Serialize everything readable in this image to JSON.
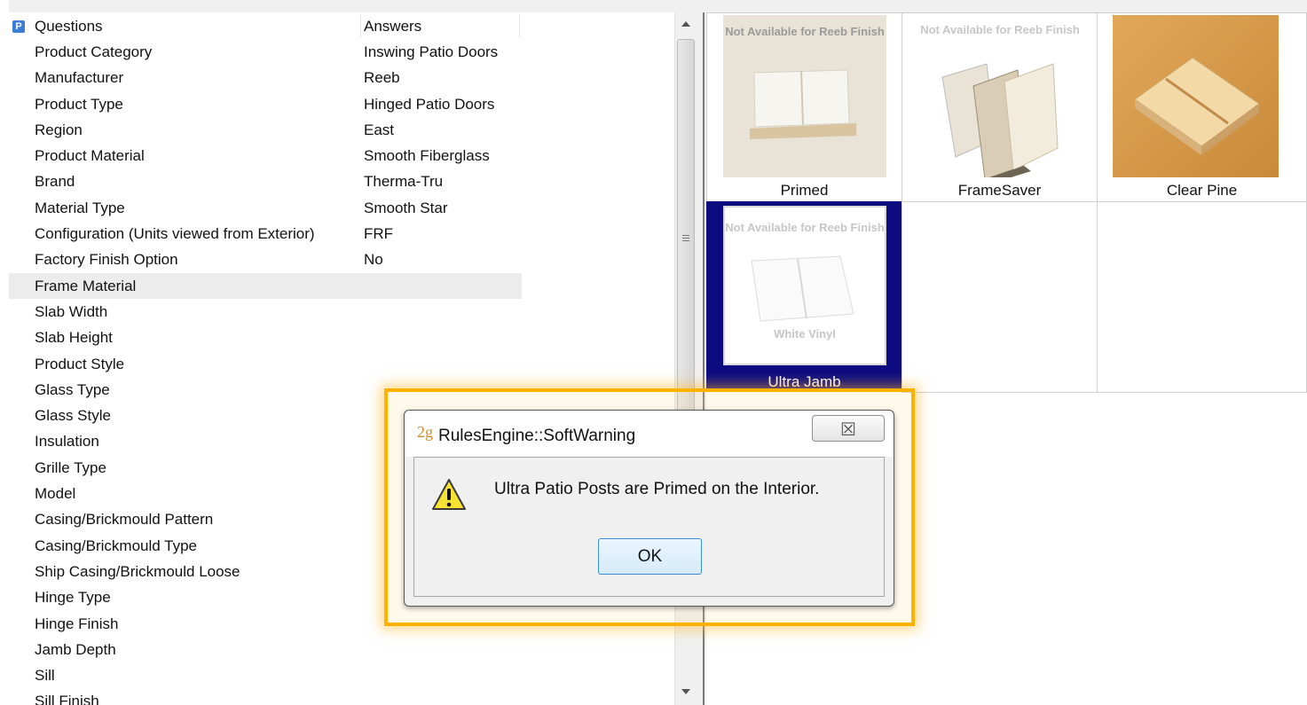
{
  "grid": {
    "col_questions": "Questions",
    "col_answers": "Answers",
    "rows": [
      {
        "q": "Product Category",
        "a": "Inswing Patio Doors"
      },
      {
        "q": "Manufacturer",
        "a": "Reeb"
      },
      {
        "q": "Product Type",
        "a": "Hinged Patio Doors"
      },
      {
        "q": "Region",
        "a": "East"
      },
      {
        "q": "Product Material",
        "a": "Smooth Fiberglass"
      },
      {
        "q": "Brand",
        "a": "Therma-Tru"
      },
      {
        "q": "Material Type",
        "a": "Smooth Star"
      },
      {
        "q": "Configuration (Units viewed from Exterior)",
        "a": "FRF"
      },
      {
        "q": "Factory Finish Option",
        "a": "No"
      },
      {
        "q": "Frame Material",
        "a": ""
      },
      {
        "q": "Slab Width",
        "a": ""
      },
      {
        "q": "Slab Height",
        "a": ""
      },
      {
        "q": "Product Style",
        "a": ""
      },
      {
        "q": "Glass Type",
        "a": ""
      },
      {
        "q": "Glass Style",
        "a": ""
      },
      {
        "q": "Insulation",
        "a": ""
      },
      {
        "q": "Grille Type",
        "a": ""
      },
      {
        "q": "Model",
        "a": ""
      },
      {
        "q": "Casing/Brickmould Pattern",
        "a": ""
      },
      {
        "q": "Casing/Brickmould Type",
        "a": ""
      },
      {
        "q": "Ship Casing/Brickmould Loose",
        "a": ""
      },
      {
        "q": "Hinge Type",
        "a": ""
      },
      {
        "q": "Hinge Finish",
        "a": ""
      },
      {
        "q": "Jamb Depth",
        "a": ""
      },
      {
        "q": "Sill",
        "a": ""
      },
      {
        "q": "Sill Finish",
        "a": ""
      }
    ],
    "selected_row": "Frame Material"
  },
  "options": {
    "tiles": [
      {
        "label": "Primed",
        "overlay": "Not Available for Reeb Finish"
      },
      {
        "label": "FrameSaver",
        "overlay": "Not Available for Reeb Finish"
      },
      {
        "label": "Clear Pine",
        "overlay": ""
      },
      {
        "label": "Ultra Jamb",
        "overlay": "Not Available for Reeb Finish",
        "overlay2": "White Vinyl"
      }
    ],
    "selected": "Ultra Jamb"
  },
  "dialog": {
    "app_icon": "2g",
    "title": "RulesEngine::SoftWarning",
    "close_glyph": "☒",
    "message": "Ultra Patio Posts are Primed on the Interior.",
    "ok_label": "OK",
    "icon": "warning-icon"
  },
  "colors": {
    "selection_blue": "#0c0c80",
    "highlight_orange": "#ffb300"
  }
}
